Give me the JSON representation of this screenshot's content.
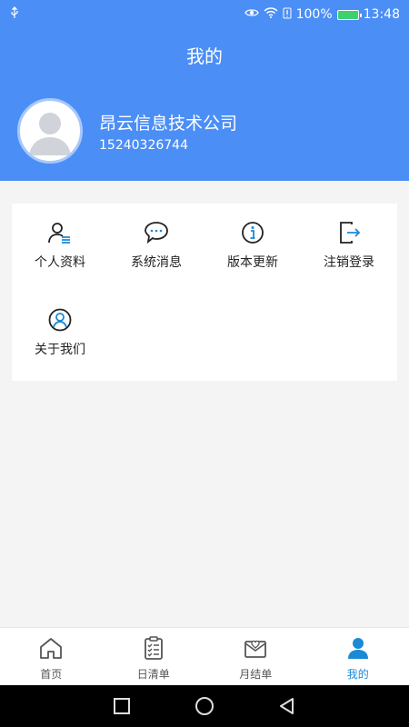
{
  "status_bar": {
    "battery": "100%",
    "time": "13:48"
  },
  "header": {
    "title": "我的"
  },
  "profile": {
    "company": "昂云信息技术公司",
    "phone": "15240326744"
  },
  "menu": {
    "items": [
      {
        "label": "个人资料",
        "icon": "user-list-icon"
      },
      {
        "label": "系统消息",
        "icon": "chat-bubble-icon"
      },
      {
        "label": "版本更新",
        "icon": "info-icon"
      },
      {
        "label": "注销登录",
        "icon": "logout-icon"
      },
      {
        "label": "关于我们",
        "icon": "user-circle-icon"
      }
    ]
  },
  "tabs": [
    {
      "label": "首页",
      "icon": "home-icon"
    },
    {
      "label": "日清单",
      "icon": "clipboard-icon"
    },
    {
      "label": "月结单",
      "icon": "mail-heart-icon"
    },
    {
      "label": "我的",
      "icon": "person-icon",
      "active": true
    }
  ],
  "colors": {
    "header_bg": "#4b8ef6",
    "active_tab": "#1a8ad6"
  }
}
